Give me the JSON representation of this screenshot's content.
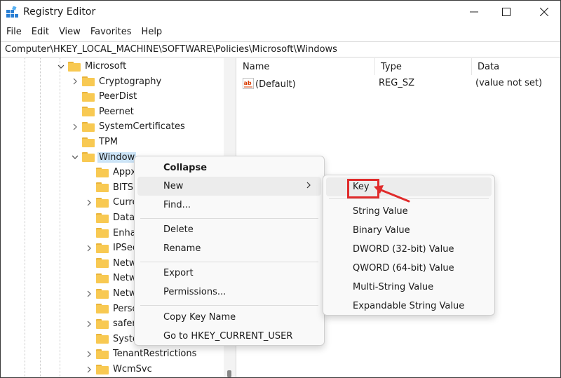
{
  "window": {
    "title": "Registry Editor",
    "controls": {
      "minimize": "minimize-icon",
      "maximize": "maximize-icon",
      "close": "close-icon"
    }
  },
  "menubar": [
    "File",
    "Edit",
    "View",
    "Favorites",
    "Help"
  ],
  "address": "Computer\\HKEY_LOCAL_MACHINE\\SOFTWARE\\Policies\\Microsoft\\Windows",
  "tree": {
    "items": [
      {
        "label": "Microsoft",
        "expanded": true
      },
      {
        "label": "Cryptography",
        "expanded": false
      },
      {
        "label": "PeerDist",
        "expanded": null
      },
      {
        "label": "Peernet",
        "expanded": null
      },
      {
        "label": "SystemCertificates",
        "expanded": false
      },
      {
        "label": "TPM",
        "expanded": null
      },
      {
        "label": "Window",
        "expanded": true,
        "selected": true
      },
      {
        "label": "Appx",
        "expanded": null
      },
      {
        "label": "BITS",
        "expanded": null
      },
      {
        "label": "Curre",
        "expanded": false
      },
      {
        "label": "DataC",
        "expanded": null
      },
      {
        "label": "Enhar",
        "expanded": null
      },
      {
        "label": "IPSec",
        "expanded": false
      },
      {
        "label": "Netw",
        "expanded": null
      },
      {
        "label": "Netw",
        "expanded": null
      },
      {
        "label": "Netw",
        "expanded": false
      },
      {
        "label": "Perso",
        "expanded": null
      },
      {
        "label": "safer",
        "expanded": false
      },
      {
        "label": "Syste",
        "expanded": null
      },
      {
        "label": "TenantRestrictions",
        "expanded": false
      },
      {
        "label": "WcmSvc",
        "expanded": false
      }
    ]
  },
  "list": {
    "headers": {
      "name": "Name",
      "type": "Type",
      "data": "Data"
    },
    "rows": [
      {
        "name": "(Default)",
        "type": "REG_SZ",
        "data": "(value not set)"
      }
    ]
  },
  "context_menu": {
    "items": [
      "Collapse",
      "New",
      "Find...",
      "Delete",
      "Rename",
      "Export",
      "Permissions...",
      "Copy Key Name",
      "Go to HKEY_CURRENT_USER"
    ]
  },
  "submenu": {
    "items": [
      "Key",
      "String Value",
      "Binary Value",
      "DWORD (32-bit) Value",
      "QWORD (64-bit) Value",
      "Multi-String Value",
      "Expandable String Value"
    ]
  },
  "colors": {
    "highlight": "#e02b2b",
    "selection": "#cce4f7",
    "folder": "#f8c952"
  }
}
